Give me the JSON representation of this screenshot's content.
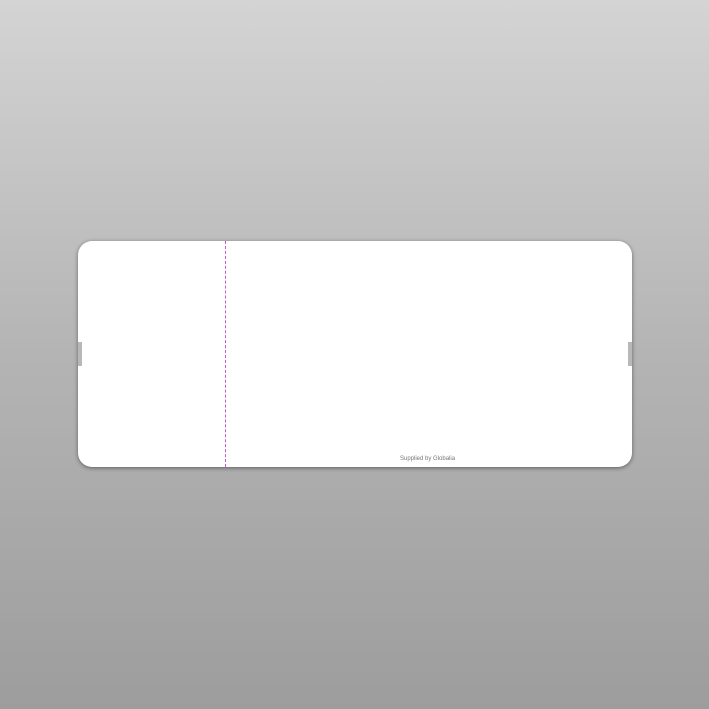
{
  "ticket": {
    "credit_text": "Supplied by Globalia"
  },
  "colors": {
    "perforation": "#c45ac4",
    "ticket_background": "#ffffff"
  }
}
